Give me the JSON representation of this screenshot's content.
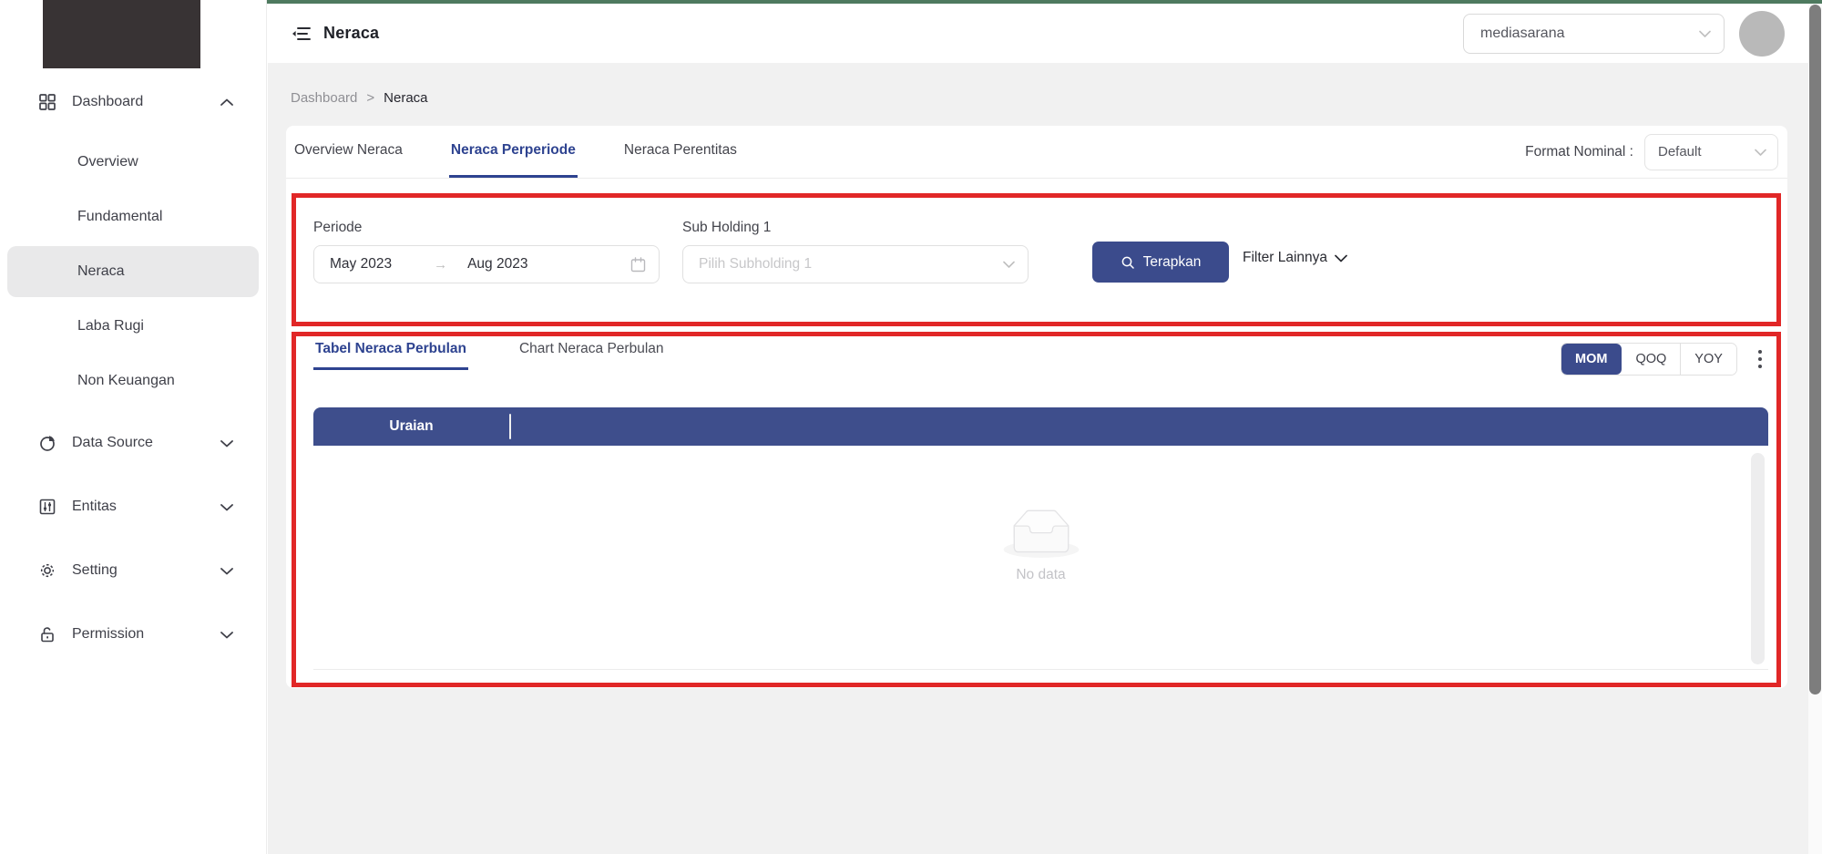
{
  "header": {
    "title": "Neraca",
    "org_select_value": "mediasarana"
  },
  "sidebar": {
    "dashboard": {
      "label": "Dashboard"
    },
    "dashboard_children": [
      {
        "label": "Overview"
      },
      {
        "label": "Fundamental"
      },
      {
        "label": "Neraca",
        "active": true
      },
      {
        "label": "Laba Rugi"
      },
      {
        "label": "Non Keuangan"
      }
    ],
    "groups": [
      {
        "label": "Data Source"
      },
      {
        "label": "Entitas"
      },
      {
        "label": "Setting"
      },
      {
        "label": "Permission"
      }
    ]
  },
  "breadcrumb": {
    "items": [
      "Dashboard",
      "Neraca"
    ],
    "separator": ">"
  },
  "page_tabs": [
    {
      "label": "Overview Neraca",
      "active": false
    },
    {
      "label": "Neraca Perperiode",
      "active": true
    },
    {
      "label": "Neraca Perentitas",
      "active": false
    }
  ],
  "format_nominal": {
    "label": "Format Nominal :",
    "value": "Default"
  },
  "filters": {
    "periode": {
      "label": "Periode",
      "start": "May 2023",
      "arrow": "→",
      "end": "Aug 2023"
    },
    "sub_holding": {
      "label": "Sub Holding 1",
      "placeholder": "Pilih Subholding 1"
    },
    "apply_button": "Terapkan",
    "more_filters": "Filter Lainnya"
  },
  "table_section": {
    "tabs": [
      {
        "label": "Tabel Neraca Perbulan",
        "active": true
      },
      {
        "label": "Chart Neraca Perbulan",
        "active": false
      }
    ],
    "period_modes": [
      {
        "label": "MOM",
        "active": true
      },
      {
        "label": "QOQ",
        "active": false
      },
      {
        "label": "YOY",
        "active": false
      }
    ],
    "table": {
      "columns": [
        "Uraian"
      ],
      "empty_text": "No data"
    }
  },
  "colors": {
    "primary_navy": "#3b4b8c",
    "annotation_red": "#e12727",
    "top_accent_green": "#4e7a5f",
    "logo_background": "#383334"
  }
}
